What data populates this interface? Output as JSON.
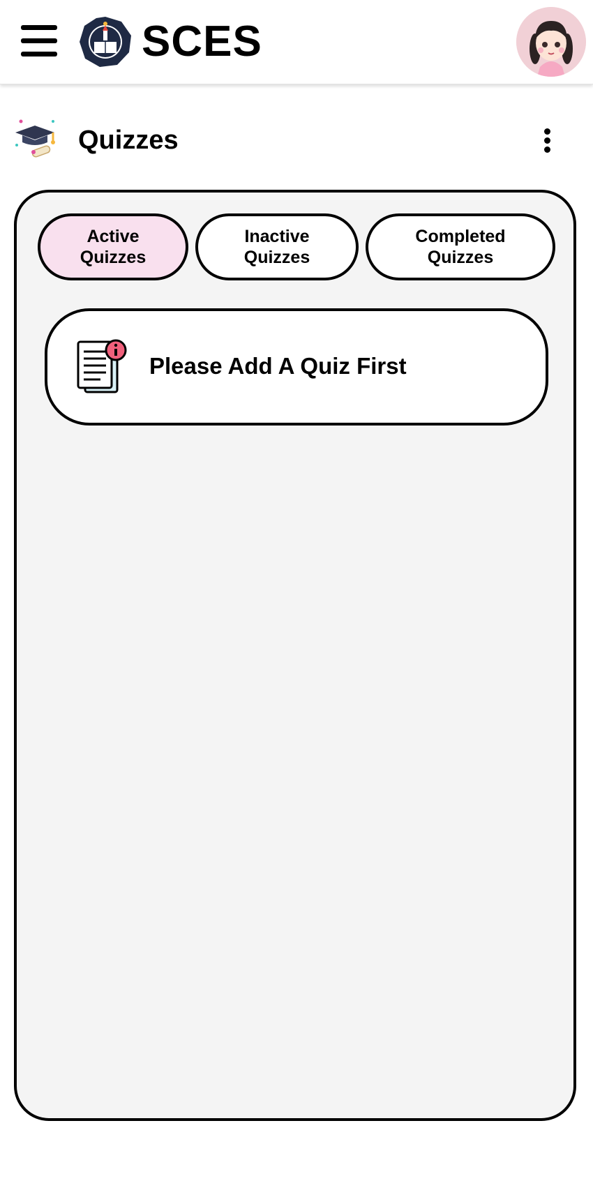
{
  "header": {
    "app_title": "SCES",
    "logo_icon": "school-seal-logo",
    "menu_icon": "hamburger-menu-icon",
    "avatar_icon": "girl-avatar-icon"
  },
  "section": {
    "title": "Quizzes",
    "icon": "graduation-cap-diploma-icon",
    "more_icon": "more-vertical-icon"
  },
  "tabs": [
    {
      "label": "Active\nQuizzes",
      "active": true
    },
    {
      "label": "Inactive\nQuizzes",
      "active": false
    },
    {
      "label": "Completed\nQuizzes",
      "active": false
    }
  ],
  "empty_state": {
    "message": "Please Add A Quiz First",
    "icon": "document-info-icon"
  },
  "colors": {
    "active_tab_bg": "#f9e0ee",
    "panel_bg": "#f4f4f4",
    "border": "#000000",
    "avatar_bg": "#f1d0d6",
    "info_badge": "#f0607c"
  }
}
